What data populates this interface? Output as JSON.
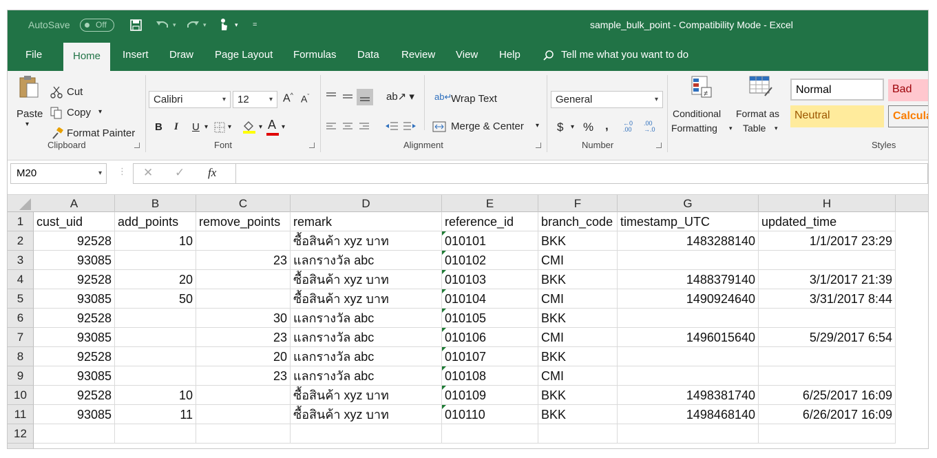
{
  "titlebar": {
    "autosave_label": "AutoSave",
    "autosave_state": "Off",
    "title": "sample_bulk_point  -  Compatibility Mode  -  Excel"
  },
  "tabs": [
    "File",
    "Home",
    "Insert",
    "Draw",
    "Page Layout",
    "Formulas",
    "Data",
    "Review",
    "View",
    "Help"
  ],
  "tell_me": "Tell me what you want to do",
  "ribbon": {
    "clipboard": {
      "paste": "Paste",
      "cut": "Cut",
      "copy": "Copy",
      "format_painter": "Format Painter",
      "label": "Clipboard"
    },
    "font": {
      "family": "Calibri",
      "size": "12",
      "bold": "B",
      "italic": "I",
      "underline": "U",
      "label": "Font"
    },
    "alignment": {
      "wrap_text": "Wrap Text",
      "merge_center": "Merge & Center",
      "label": "Alignment"
    },
    "number": {
      "format": "General",
      "currency": "$",
      "percent": "%",
      "comma": ",",
      "label": "Number"
    },
    "styles": {
      "conditional": "Conditional",
      "formatting": "Formatting",
      "format_as": "Format as",
      "table": "Table",
      "normal": "Normal",
      "bad": "Bad",
      "neutral": "Neutral",
      "calculation": "Calcula",
      "label": "Styles"
    }
  },
  "formula_bar": {
    "name_box": "M20",
    "fx": "fx",
    "value": ""
  },
  "sheet": {
    "columns": [
      "A",
      "B",
      "C",
      "D",
      "E",
      "F",
      "G",
      "H"
    ],
    "rows": [
      {
        "n": "1",
        "cells": [
          "cust_uid",
          "add_points",
          "remove_points",
          "remark",
          "reference_id",
          "branch_code",
          "timestamp_UTC",
          "updated_time"
        ]
      },
      {
        "n": "2",
        "cells": [
          "92528",
          "10",
          "",
          "ซื้อสินค้า xyz บาท",
          "010101",
          "BKK",
          "1483288140",
          "1/1/2017 23:29"
        ]
      },
      {
        "n": "3",
        "cells": [
          "93085",
          "",
          "23",
          "แลกรางวัล abc",
          "010102",
          "CMI",
          "",
          ""
        ]
      },
      {
        "n": "4",
        "cells": [
          "92528",
          "20",
          "",
          "ซื้อสินค้า xyz บาท",
          "010103",
          "BKK",
          "1488379140",
          "3/1/2017 21:39"
        ]
      },
      {
        "n": "5",
        "cells": [
          "93085",
          "50",
          "",
          "ซื้อสินค้า xyz บาท",
          "010104",
          "CMI",
          "1490924640",
          "3/31/2017 8:44"
        ]
      },
      {
        "n": "6",
        "cells": [
          "92528",
          "",
          "30",
          "แลกรางวัล abc",
          "010105",
          "BKK",
          "",
          ""
        ]
      },
      {
        "n": "7",
        "cells": [
          "93085",
          "",
          "23",
          "แลกรางวัล abc",
          "010106",
          "CMI",
          "1496015640",
          "5/29/2017 6:54"
        ]
      },
      {
        "n": "8",
        "cells": [
          "92528",
          "",
          "20",
          "แลกรางวัล abc",
          "010107",
          "BKK",
          "",
          ""
        ]
      },
      {
        "n": "9",
        "cells": [
          "93085",
          "",
          "23",
          "แลกรางวัล abc",
          "010108",
          "CMI",
          "",
          ""
        ]
      },
      {
        "n": "10",
        "cells": [
          "92528",
          "10",
          "",
          "ซื้อสินค้า xyz บาท",
          "010109",
          "BKK",
          "1498381740",
          "6/25/2017 16:09"
        ]
      },
      {
        "n": "11",
        "cells": [
          "93085",
          "11",
          "",
          "ซื้อสินค้า xyz บาท",
          "010110",
          "BKK",
          "1498468140",
          "6/26/2017 16:09"
        ]
      },
      {
        "n": "12",
        "cells": [
          "",
          "",
          "",
          "",
          "",
          "",
          "",
          ""
        ]
      }
    ]
  },
  "colors": {
    "excel_green": "#217346",
    "ribbon_bg": "#f3f3f3",
    "bad_fill": "#ffc7ce",
    "neutral_fill": "#ffeb9c",
    "error_triangle": "#1e7b34"
  }
}
